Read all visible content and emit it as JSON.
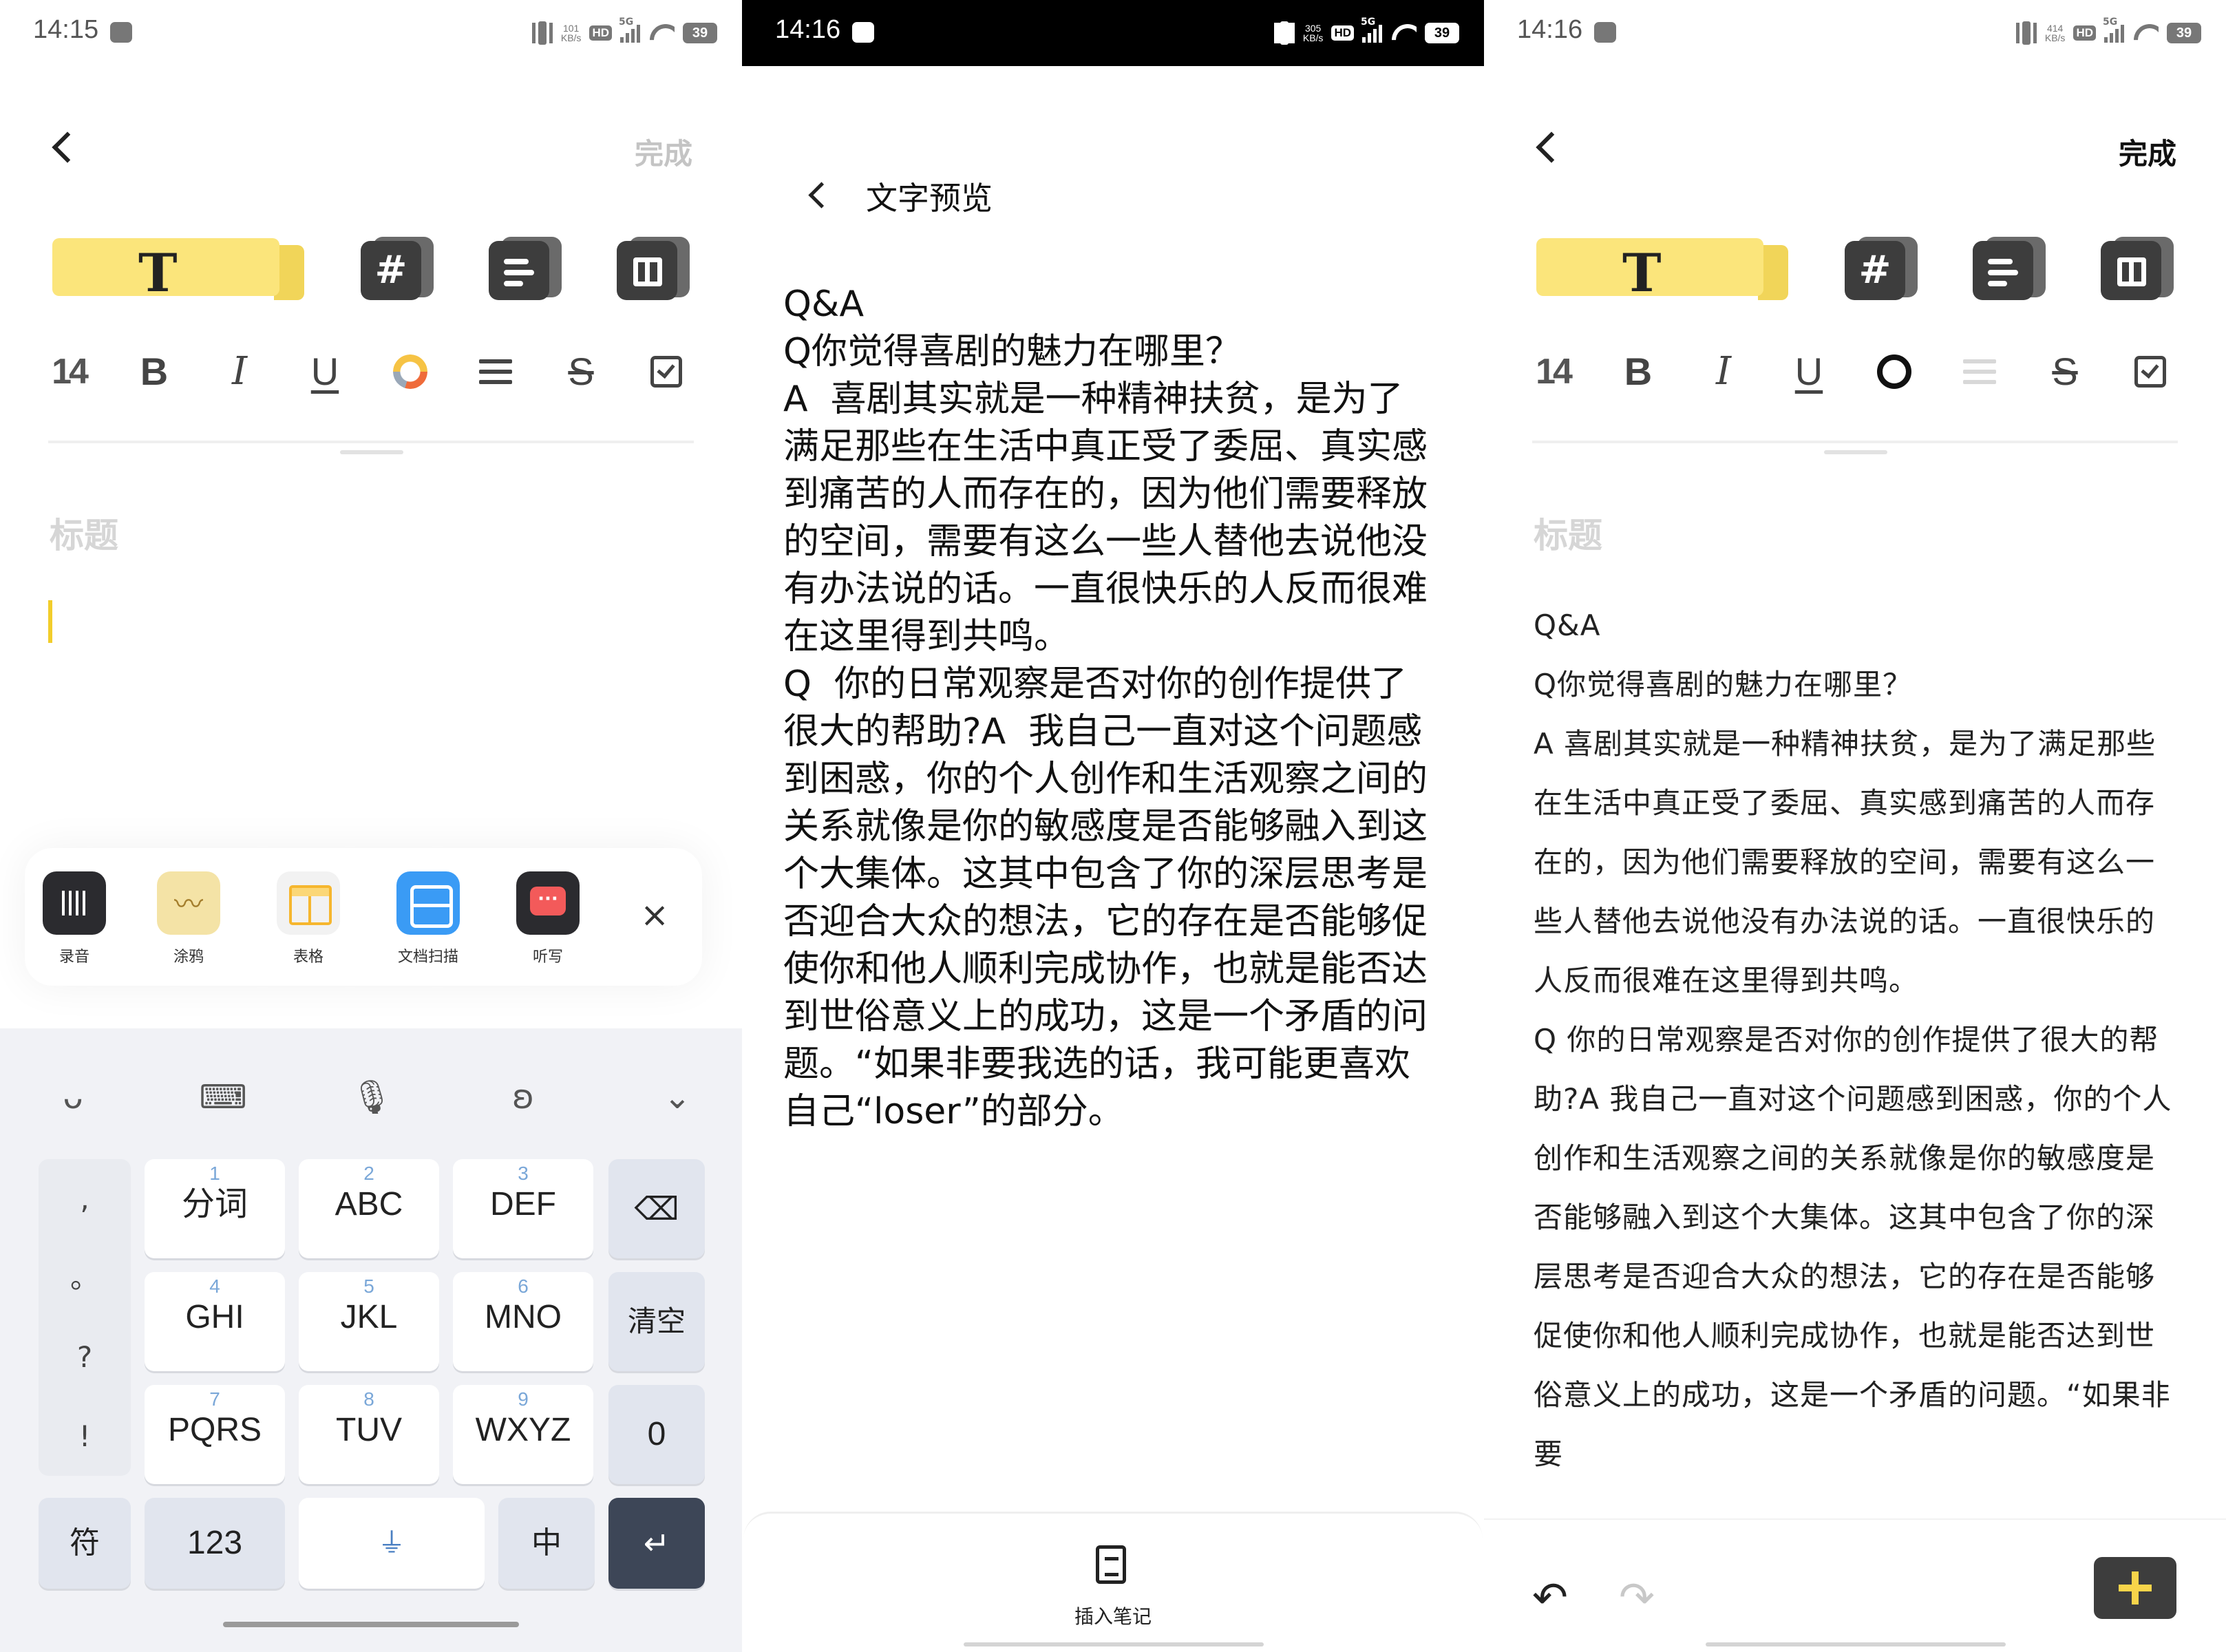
{
  "panel1": {
    "status": {
      "time": "14:15",
      "speed": "101\nKB/s",
      "hd": "HD",
      "net": "5G",
      "battery": "39"
    },
    "done_label": "完成",
    "text_tab": "T",
    "hash_tab": "#",
    "format": {
      "size": "14",
      "bold": "B",
      "italic": "I",
      "underline": "U",
      "strike": "S"
    },
    "title_placeholder": "标题",
    "plugins": [
      {
        "label": "录音",
        "icon": "audio-record-icon"
      },
      {
        "label": "涂鸦",
        "icon": "doodle-icon"
      },
      {
        "label": "表格",
        "icon": "table-icon"
      },
      {
        "label": "文档扫描",
        "icon": "scan-icon"
      },
      {
        "label": "听写",
        "icon": "dictation-icon"
      }
    ],
    "plugin_close": "×",
    "keyboard": {
      "punct": [
        ",",
        "。",
        "?",
        "!"
      ],
      "keys": [
        {
          "num": "1",
          "label": "分词"
        },
        {
          "num": "2",
          "label": "ABC"
        },
        {
          "num": "3",
          "label": "DEF"
        },
        {
          "num": "4",
          "label": "GHI"
        },
        {
          "num": "5",
          "label": "JKL"
        },
        {
          "num": "6",
          "label": "MNO"
        },
        {
          "num": "7",
          "label": "PQRS"
        },
        {
          "num": "8",
          "label": "TUV"
        },
        {
          "num": "9",
          "label": "WXYZ"
        }
      ],
      "clear": "清空",
      "zero": "0",
      "symbols": "符",
      "numbers": "123",
      "lang": "中"
    }
  },
  "panel2": {
    "status": {
      "time": "14:16",
      "speed": "305\nKB/s",
      "hd": "HD",
      "net": "5G",
      "battery": "39"
    },
    "title": "文字预览",
    "text": "Q&A\nQ你觉得喜剧的魅力在哪里？\nA  喜剧其实就是一种精神扶贫，是为了满足那些在生活中真正受了委屈、真实感到痛苦的人而存在的，因为他们需要释放的空间，需要有这么一些人替他去说他没有办法说的话。一直很快乐的人反而很难在这里得到共鸣。\nQ  你的日常观察是否对你的创作提供了很大的帮助?A  我自己一直对这个问题感到困惑，你的个人创作和生活观察之间的关系就像是你的敏感度是否能够融入到这个大集体。这其中包含了你的深层思考是否迎合大众的想法，它的存在是否能够促使你和他人顺利完成协作，也就是能否达到世俗意义上的成功，这是一个矛盾的问题。“如果非要我选的话，我可能更喜欢自己“loser”的部分。",
    "insert_label": "插入笔记"
  },
  "panel3": {
    "status": {
      "time": "14:16",
      "speed": "414\nKB/s",
      "hd": "HD",
      "net": "5G",
      "battery": "39"
    },
    "done_label": "完成",
    "title_placeholder": "标题",
    "body": [
      "Q&A",
      "Q你觉得喜剧的魅力在哪里？",
      "A  喜剧其实就是一种精神扶贫，是为了满足那些在生活中真正受了委屈、真实感到痛苦的人而存在的，因为他们需要释放的空间，需要有这么一些人替他去说他没有办法说的话。一直很快乐的人反而很难在这里得到共鸣。",
      "Q  你的日常观察是否对你的创作提供了很大的帮助?A  我自己一直对这个问题感到困惑，你的个人创作和生活观察之间的关系就像是你的敏感度是否能够融入到这个大集体。这其中包含了你的深层思考是否迎合大众的想法，它的存在是否能够促使你和他人顺利完成协作，也就是能否达到世俗意义上的成功，这是一个矛盾的问题。“如果非要"
    ]
  },
  "colors": {
    "accent_yellow": "#fbe57b",
    "dark_key": "#3d4657",
    "key_number": "#7aa7d8"
  }
}
